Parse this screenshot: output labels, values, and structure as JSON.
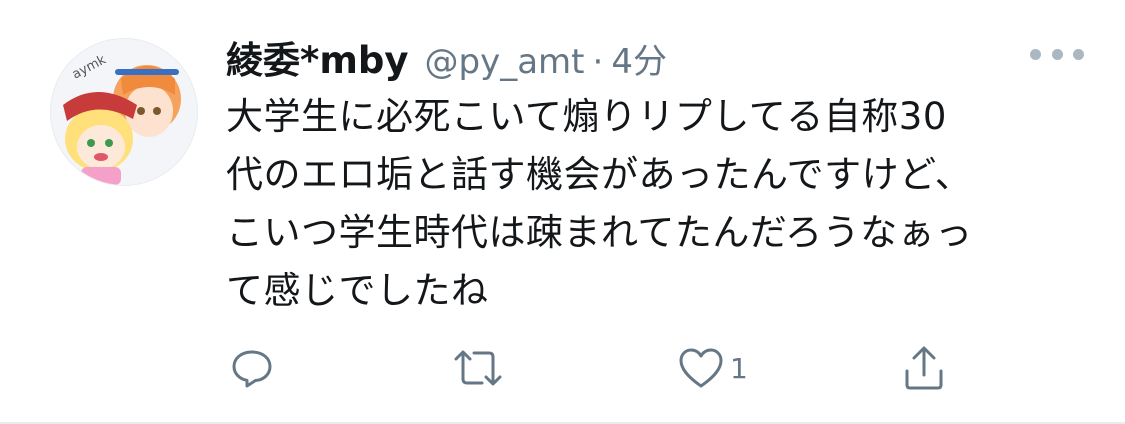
{
  "tweet": {
    "display_name": "綾委*mby",
    "handle": "@py_amt",
    "separator": "·",
    "time": "4分",
    "avatar_text": "aymk",
    "body_lines": [
      "大学生に必死こいて煽りリプしてる自称30",
      "代のエロ垢と話す機会があったんですけど、",
      "こいつ学生時代は疎まれてたんだろうなぁっ",
      "て感じでしたね"
    ],
    "actions": {
      "reply_icon": "reply-icon",
      "retweet_icon": "retweet-icon",
      "like_icon": "like-icon",
      "like_count": "1",
      "share_icon": "share-icon"
    },
    "more_icon": "more-icon"
  },
  "colors": {
    "text_primary": "#14171a",
    "text_secondary": "#657786",
    "divider": "#e6ecf0"
  }
}
